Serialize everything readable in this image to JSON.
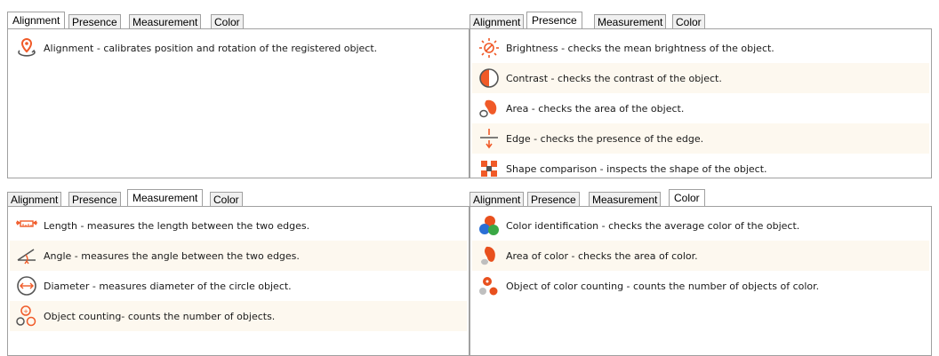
{
  "panels": {
    "alignment": {
      "tabs": [
        "Alignment",
        "Presence",
        "Measurement",
        "Color"
      ],
      "items": [
        {
          "icon": "location-rotate-icon",
          "text": "Alignment - calibrates position and rotation of the registered object."
        }
      ]
    },
    "presence": {
      "tabs": [
        "Alignment",
        "Presence",
        "Measurement",
        "Color"
      ],
      "items": [
        {
          "icon": "brightness-icon",
          "text": "Brightness - checks the mean brightness of the object."
        },
        {
          "icon": "contrast-icon",
          "text": "Contrast - checks the contrast of the object."
        },
        {
          "icon": "area-icon",
          "text": "Area - checks the area of the object."
        },
        {
          "icon": "edge-icon",
          "text": "Edge - checks the presence of the edge."
        },
        {
          "icon": "shape-comparison-icon",
          "text": "Shape comparison - inspects the shape of the object."
        }
      ]
    },
    "measurement": {
      "tabs": [
        "Alignment",
        "Presence",
        "Measurement",
        "Color"
      ],
      "items": [
        {
          "icon": "length-icon",
          "text": "Length - measures the length between the two edges."
        },
        {
          "icon": "angle-icon",
          "text": "Angle - measures the angle between the two edges."
        },
        {
          "icon": "diameter-icon",
          "text": "Diameter - measures diameter of the circle object."
        },
        {
          "icon": "object-counting-icon",
          "text": "Object counting- counts the number of objects."
        }
      ]
    },
    "color": {
      "tabs": [
        "Alignment",
        "Presence",
        "Measurement",
        "Color"
      ],
      "items": [
        {
          "icon": "color-identification-icon",
          "text": "Color identification - checks the average color of the object."
        },
        {
          "icon": "color-area-icon",
          "text": "Area of color - checks the area of color."
        },
        {
          "icon": "color-counting-icon",
          "text": "Object of color counting - counts the number of objects of color."
        }
      ]
    }
  },
  "colors": {
    "accent": "#f05a28",
    "row_alt": "#fdf8ef",
    "border": "#a0a0a0",
    "tab_bg": "#f0f0f0"
  }
}
